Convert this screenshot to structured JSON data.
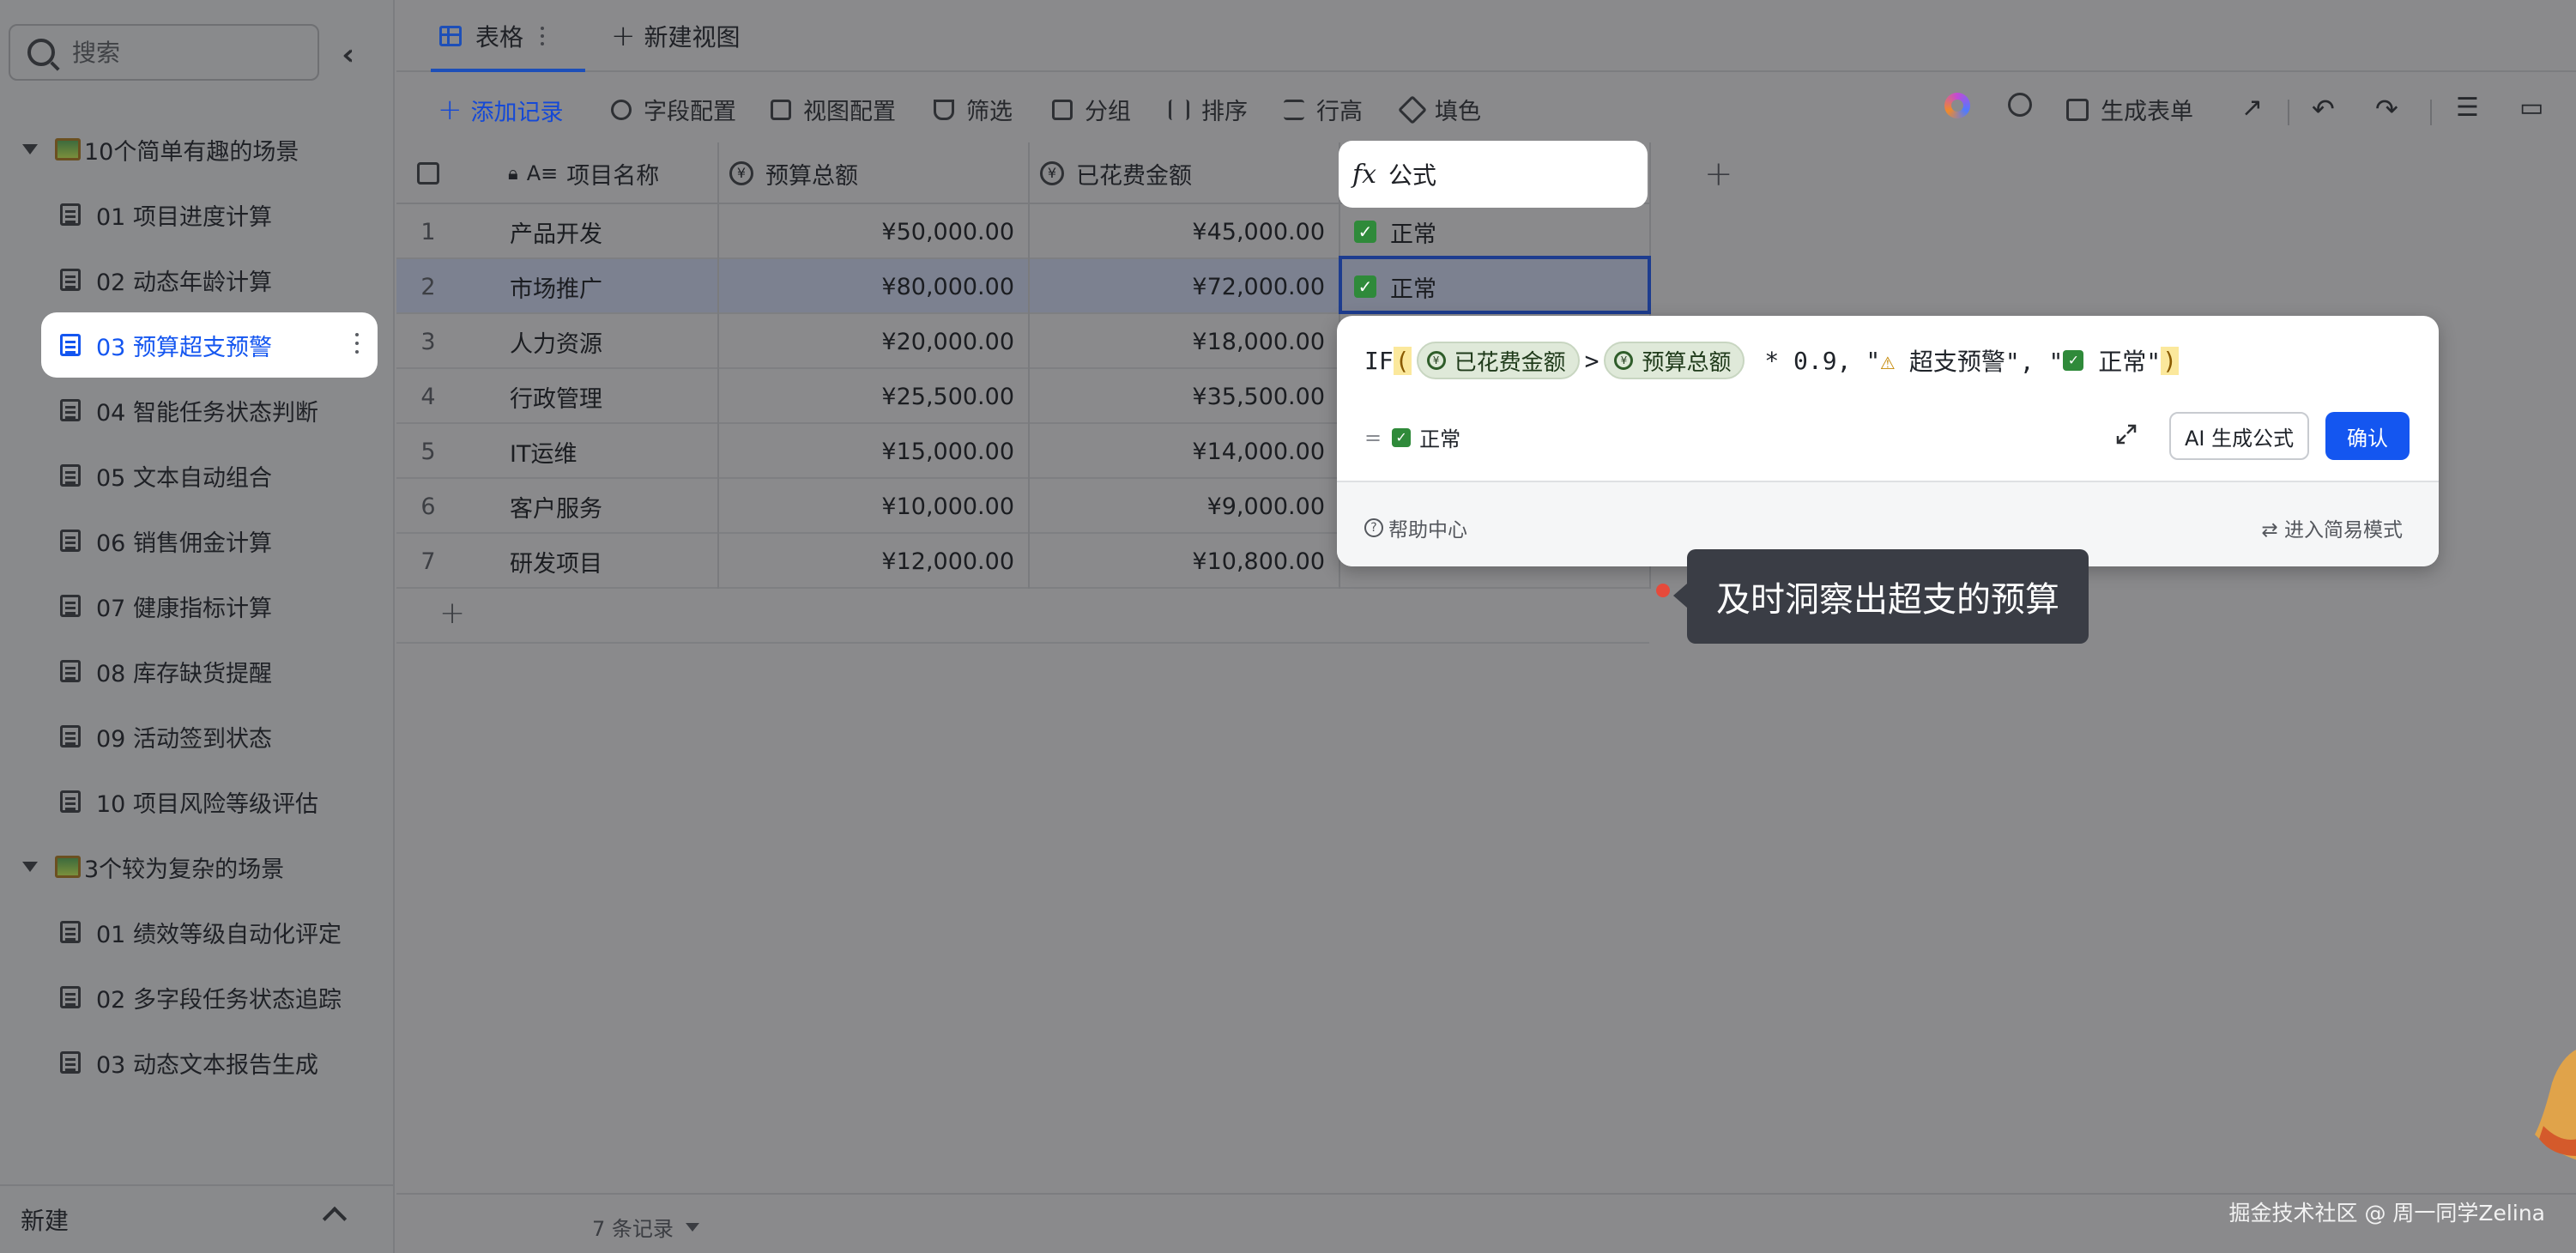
{
  "sidebar": {
    "search_placeholder": "搜索",
    "groups": [
      {
        "label": "10个简单有趣的场景",
        "items": [
          {
            "label": "01 项目进度计算"
          },
          {
            "label": "02 动态年龄计算"
          },
          {
            "label": "03 预算超支预警",
            "active": true
          },
          {
            "label": "04 智能任务状态判断"
          },
          {
            "label": "05 文本自动组合"
          },
          {
            "label": "06 销售佣金计算"
          },
          {
            "label": "07 健康指标计算"
          },
          {
            "label": "08 库存缺货提醒"
          },
          {
            "label": "09 活动签到状态"
          },
          {
            "label": "10 项目风险等级评估"
          }
        ]
      },
      {
        "label": "3个较为复杂的场景",
        "items": [
          {
            "label": "01 绩效等级自动化评定"
          },
          {
            "label": "02 多字段任务状态追踪"
          },
          {
            "label": "03 动态文本报告生成"
          }
        ]
      }
    ],
    "footer_label": "新建"
  },
  "tabs": {
    "table_label": "表格",
    "new_view_label": "新建视图"
  },
  "toolbar": {
    "add_record": "添加记录",
    "field_config": "字段配置",
    "view_config": "视图配置",
    "filter": "筛选",
    "group": "分组",
    "sort": "排序",
    "row_height": "行高",
    "fill_color": "填色",
    "generate_form": "生成表单"
  },
  "columns": {
    "name": "项目名称",
    "budget": "预算总额",
    "spent": "已花费金额",
    "formula": "公式"
  },
  "rows": [
    {
      "n": "1",
      "name": "产品开发",
      "budget": "¥50,000.00",
      "spent": "¥45,000.00",
      "status": "正常"
    },
    {
      "n": "2",
      "name": "市场推广",
      "budget": "¥80,000.00",
      "spent": "¥72,000.00",
      "status": "正常"
    },
    {
      "n": "3",
      "name": "人力资源",
      "budget": "¥20,000.00",
      "spent": "¥18,000.00",
      "status": ""
    },
    {
      "n": "4",
      "name": "行政管理",
      "budget": "¥25,500.00",
      "spent": "¥35,500.00",
      "status": ""
    },
    {
      "n": "5",
      "name": "IT运维",
      "budget": "¥15,000.00",
      "spent": "¥14,000.00",
      "status": ""
    },
    {
      "n": "6",
      "name": "客户服务",
      "budget": "¥10,000.00",
      "spent": "¥9,000.00",
      "status": ""
    },
    {
      "n": "7",
      "name": "研发项目",
      "budget": "¥12,000.00",
      "spent": "¥10,800.00",
      "status": ""
    }
  ],
  "formula_editor": {
    "fn": "IF",
    "field_a": "已花费金额",
    "op": ">",
    "field_b": "预算总额",
    "tail_a": " * 0.9, \"",
    "warn_text": " 超支预警\", \"",
    "ok_text": " 正常\"",
    "result_eq": "=",
    "result_text": "正常",
    "ai_button": "AI 生成公式",
    "confirm_button": "确认",
    "help": "帮助中心",
    "simple_mode": "⇄ 进入简易模式"
  },
  "tooltip": "及时洞察出超支的预算",
  "status": {
    "record_count": "7 条记录"
  },
  "watermark": "掘金技术社区 @ 周一同学Zelina",
  "colors": {
    "accent": "#1456f0",
    "confirm": "#1456f0",
    "tooltip_bg": "#3a3d45"
  }
}
